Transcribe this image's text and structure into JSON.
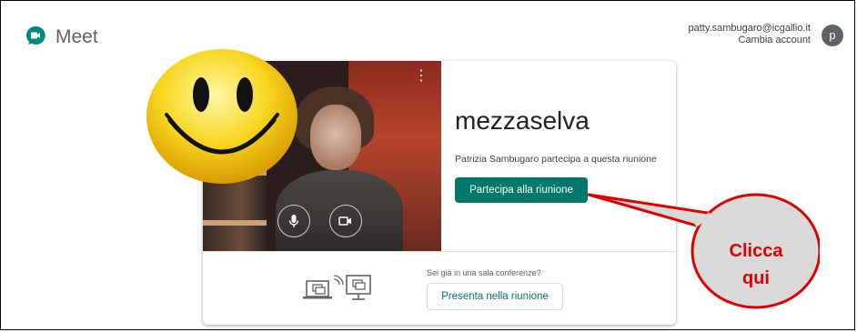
{
  "app": {
    "name": "Meet"
  },
  "account": {
    "email": "patty.sambugaro@icgallio.it",
    "switch_label": "Cambia account",
    "avatar_letter": "p"
  },
  "meeting": {
    "name": "mezzaselva",
    "participants_text": "Patrizia Sambugaro partecipa a questa riunione",
    "join_label": "Partecipa alla riunione"
  },
  "present": {
    "question": "Sei già in una sala conferenze?",
    "button_label": "Presenta nella riunione"
  },
  "annotation": {
    "line1": "Clicca",
    "line2": "qui"
  },
  "colors": {
    "join_button": "#00796b",
    "callout_fill": "#d9d9d9",
    "callout_stroke": "#e00000",
    "callout_text": "#e00000"
  },
  "icons": {
    "logo": "meet-logo-icon",
    "mic": "microphone-icon",
    "camera": "camera-icon",
    "more": "more-vert-icon",
    "cast": "cast-screen-icon"
  }
}
